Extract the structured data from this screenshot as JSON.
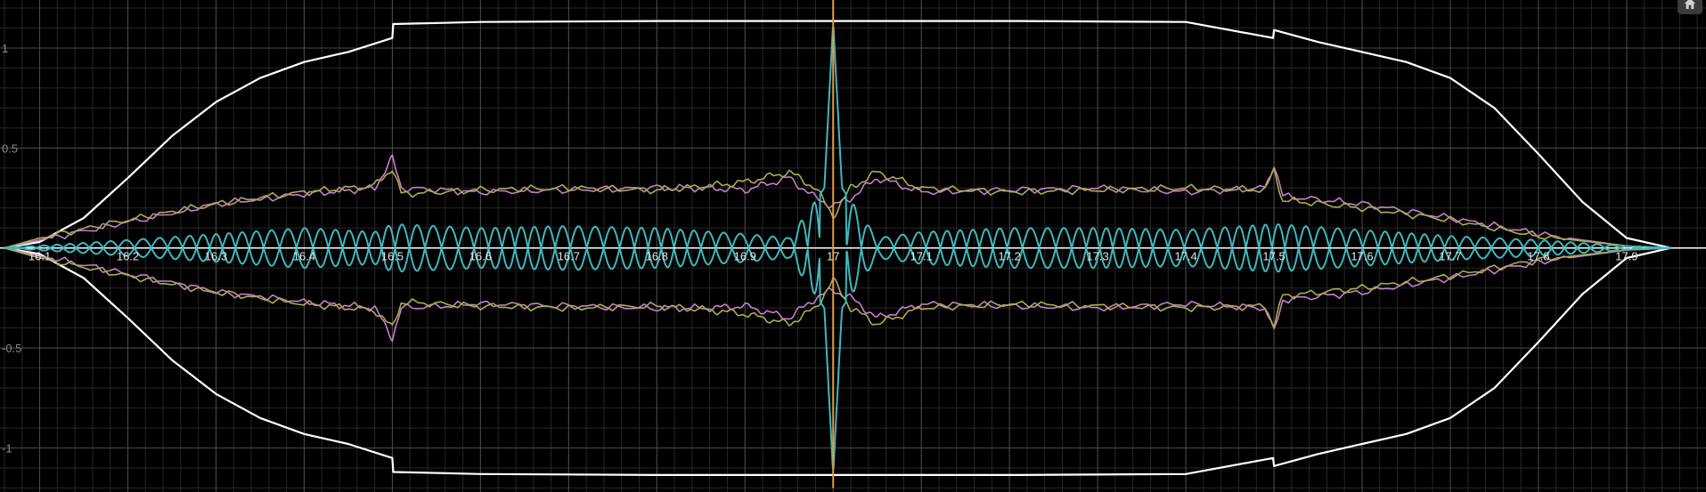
{
  "ui": {
    "home_button_icon": "home-icon"
  },
  "colors": {
    "background": "#000000",
    "grid_minor": "#262626",
    "grid_major": "#4a4a4a",
    "axis": "#ffffff",
    "envelope": "#ffffff",
    "magenta": "#c77ec9",
    "olive": "#a8ad52",
    "cyan": "#3fb7bd",
    "orange_line": "#e59a3c"
  },
  "chart_data": {
    "type": "line",
    "xlim": [
      16.055,
      17.99
    ],
    "ylim": [
      -1.22,
      1.24
    ],
    "x_ticks": [
      16.1,
      16.2,
      16.3,
      16.4,
      16.5,
      16.6,
      16.7,
      16.8,
      16.9,
      17,
      17.1,
      17.2,
      17.3,
      17.4,
      17.5,
      17.6,
      17.7,
      17.8,
      17.9
    ],
    "x_tick_labels": [
      "16.1",
      "16.2",
      "16.3",
      "16.4",
      "16.5",
      "16.6",
      "16.7",
      "16.8",
      "16.9",
      "17",
      "17.1",
      "17.2",
      "17.3",
      "17.4",
      "17.5",
      "17.6",
      "17.7",
      "17.8",
      "17.9"
    ],
    "y_ticks": [
      1,
      0.5,
      -0.5,
      -1
    ],
    "y_tick_labels": [
      "1",
      "0.5",
      "-0.5",
      "-1"
    ],
    "grid": true,
    "vertical_marker_x": 17,
    "series": [
      {
        "color_key": "envelope",
        "kind": "envelope",
        "points": [
          [
            16.06,
            0
          ],
          [
            16.1,
            0.03
          ],
          [
            16.15,
            0.15
          ],
          [
            16.2,
            0.35
          ],
          [
            16.25,
            0.56
          ],
          [
            16.3,
            0.73
          ],
          [
            16.35,
            0.85
          ],
          [
            16.4,
            0.93
          ],
          [
            16.45,
            0.98
          ],
          [
            16.5,
            1.05
          ],
          [
            16.501,
            1.12
          ],
          [
            16.6,
            1.13
          ],
          [
            16.8,
            1.135
          ],
          [
            17,
            1.135
          ],
          [
            17.2,
            1.135
          ],
          [
            17.4,
            1.13
          ],
          [
            17.499,
            1.05
          ],
          [
            17.5,
            1.09
          ],
          [
            17.55,
            1.03
          ],
          [
            17.6,
            0.98
          ],
          [
            17.65,
            0.93
          ],
          [
            17.7,
            0.85
          ],
          [
            17.75,
            0.7
          ],
          [
            17.8,
            0.47
          ],
          [
            17.85,
            0.23
          ],
          [
            17.9,
            0.05
          ],
          [
            17.95,
            0
          ]
        ]
      },
      {
        "color_key": "magenta",
        "kind": "band",
        "points": [
          [
            16.06,
            0
          ],
          [
            16.1,
            0.04
          ],
          [
            16.2,
            0.13
          ],
          [
            16.3,
            0.22
          ],
          [
            16.4,
            0.27
          ],
          [
            16.48,
            0.3
          ],
          [
            16.5,
            0.45
          ],
          [
            16.51,
            0.3
          ],
          [
            16.6,
            0.28
          ],
          [
            16.7,
            0.29
          ],
          [
            16.8,
            0.3
          ],
          [
            16.86,
            0.3
          ],
          [
            16.9,
            0.29
          ],
          [
            16.95,
            0.35
          ],
          [
            16.98,
            0.25
          ],
          [
            17,
            0.21
          ],
          [
            17.02,
            0.25
          ],
          [
            17.05,
            0.35
          ],
          [
            17.1,
            0.28
          ],
          [
            17.2,
            0.29
          ],
          [
            17.3,
            0.3
          ],
          [
            17.4,
            0.28
          ],
          [
            17.49,
            0.3
          ],
          [
            17.5,
            0.42
          ],
          [
            17.51,
            0.26
          ],
          [
            17.6,
            0.22
          ],
          [
            17.7,
            0.15
          ],
          [
            17.8,
            0.07
          ],
          [
            17.9,
            0.01
          ],
          [
            17.95,
            0
          ]
        ]
      },
      {
        "color_key": "olive",
        "kind": "band",
        "points": [
          [
            16.06,
            0
          ],
          [
            16.1,
            0.05
          ],
          [
            16.2,
            0.14
          ],
          [
            16.3,
            0.22
          ],
          [
            16.4,
            0.28
          ],
          [
            16.48,
            0.31
          ],
          [
            16.5,
            0.4
          ],
          [
            16.51,
            0.27
          ],
          [
            16.6,
            0.29
          ],
          [
            16.7,
            0.3
          ],
          [
            16.8,
            0.29
          ],
          [
            16.86,
            0.31
          ],
          [
            16.9,
            0.33
          ],
          [
            16.95,
            0.38
          ],
          [
            16.98,
            0.3
          ],
          [
            17,
            0.16
          ],
          [
            17.02,
            0.3
          ],
          [
            17.05,
            0.38
          ],
          [
            17.1,
            0.3
          ],
          [
            17.2,
            0.28
          ],
          [
            17.3,
            0.29
          ],
          [
            17.4,
            0.3
          ],
          [
            17.49,
            0.29
          ],
          [
            17.5,
            0.39
          ],
          [
            17.51,
            0.24
          ],
          [
            17.6,
            0.2
          ],
          [
            17.7,
            0.14
          ],
          [
            17.8,
            0.06
          ],
          [
            17.9,
            0.01
          ],
          [
            17.95,
            0
          ]
        ]
      },
      {
        "color_key": "cyan",
        "kind": "oscillation",
        "points": [
          [
            16.06,
            0
          ],
          [
            16.2,
            0.04
          ],
          [
            16.3,
            0.07
          ],
          [
            16.4,
            0.1
          ],
          [
            16.48,
            0.08
          ],
          [
            16.5,
            0.12
          ],
          [
            16.6,
            0.1
          ],
          [
            16.7,
            0.11
          ],
          [
            16.8,
            0.1
          ],
          [
            16.9,
            0.07
          ],
          [
            16.95,
            0.05
          ],
          [
            16.99,
            0.3
          ],
          [
            17,
            1.13
          ],
          [
            17.01,
            0.3
          ],
          [
            17.05,
            0.05
          ],
          [
            17.1,
            0.08
          ],
          [
            17.2,
            0.1
          ],
          [
            17.3,
            0.1
          ],
          [
            17.4,
            0.09
          ],
          [
            17.5,
            0.12
          ],
          [
            17.6,
            0.09
          ],
          [
            17.7,
            0.06
          ],
          [
            17.8,
            0.04
          ],
          [
            17.9,
            0.01
          ],
          [
            17.95,
            0
          ]
        ]
      },
      {
        "color_key": "orange_line",
        "kind": "vertical",
        "points": [
          [
            17,
            -1.2
          ],
          [
            17,
            1.24
          ]
        ]
      }
    ]
  }
}
